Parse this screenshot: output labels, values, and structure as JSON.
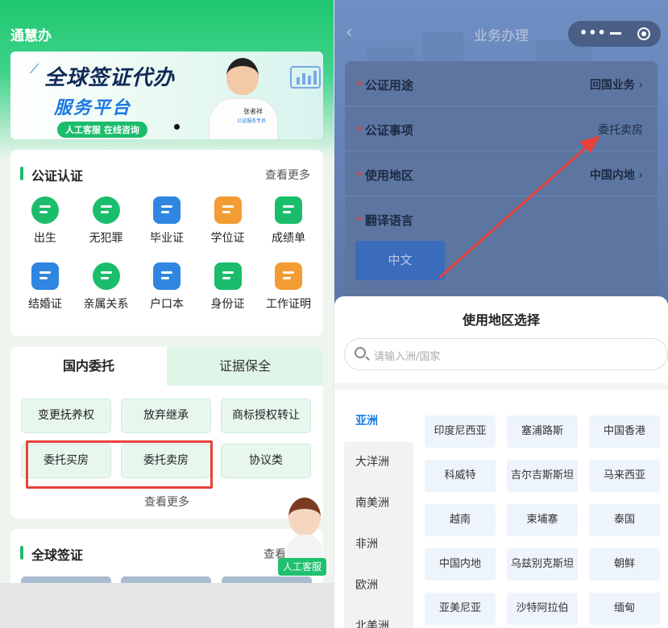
{
  "left": {
    "brand": "通慧办",
    "banner": {
      "title_line1": "全球签证代办",
      "title_line2": "服务平台",
      "tag": "人工客服 在线咨询",
      "person_name": "张者祥",
      "person_caption": "公证服务专员"
    },
    "notary": {
      "title": "公证认证",
      "more": "查看更多",
      "items": [
        {
          "label": "出生",
          "icon": "baby-face-icon",
          "color": "#1bbd6c"
        },
        {
          "label": "无犯罪",
          "icon": "police-cap-icon",
          "color": "#1bbd6c"
        },
        {
          "label": "毕业证",
          "icon": "graduation-cap-icon",
          "color": "#2f86e0"
        },
        {
          "label": "学位证",
          "icon": "open-book-icon",
          "color": "#f39c34"
        },
        {
          "label": "成绩单",
          "icon": "transcript-icon",
          "color": "#1bbd6c"
        },
        {
          "label": "结婚证",
          "icon": "couple-icon",
          "color": "#2f86e0"
        },
        {
          "label": "亲属关系",
          "icon": "family-icon",
          "color": "#1bbd6c"
        },
        {
          "label": "户口本",
          "icon": "household-book-icon",
          "color": "#2f86e0"
        },
        {
          "label": "身份证",
          "icon": "id-card-icon",
          "color": "#1bbd6c"
        },
        {
          "label": "工作证明",
          "icon": "work-badge-icon",
          "color": "#f39c34"
        }
      ]
    },
    "entrust": {
      "tab_active": "国内委托",
      "tab_other": "证据保全",
      "buttons": [
        "变更抚养权",
        "放弃继承",
        "商标授权转让",
        "委托买房",
        "委托卖房",
        "协议类"
      ],
      "more": "查看更多"
    },
    "visa": {
      "title": "全球签证",
      "more": "查看"
    },
    "agent_tag": "人工客服"
  },
  "right": {
    "nav_title": "业务办理",
    "form": {
      "rows": [
        {
          "label": "公证用途",
          "value": "回国业务",
          "chevron": true
        },
        {
          "label": "公证事项",
          "value": "委托卖房",
          "chevron": false
        },
        {
          "label": "使用地区",
          "value": "中国内地",
          "chevron": true
        },
        {
          "label": "翻译语言",
          "value": "",
          "chevron": false
        }
      ],
      "language_button": "中文"
    },
    "sheet": {
      "title": "使用地区选择",
      "search_placeholder": "请输入洲/国家",
      "continents": [
        "亚洲",
        "大洋洲",
        "南美洲",
        "非洲",
        "欧洲",
        "北美洲"
      ],
      "active_continent": 0,
      "countries": [
        "印度尼西亚",
        "塞浦路斯",
        "中国香港",
        "科威特",
        "吉尔吉斯斯坦",
        "马来西亚",
        "越南",
        "柬埔寨",
        "泰国",
        "中国内地",
        "乌兹别克斯坦",
        "朝鲜",
        "亚美尼亚",
        "沙特阿拉伯",
        "缅甸"
      ]
    }
  },
  "colors": {
    "brand_green": "#1bbd6c",
    "highlight_red": "#e8413b",
    "link_blue": "#1c7ae0"
  }
}
